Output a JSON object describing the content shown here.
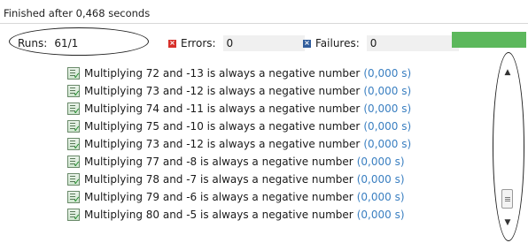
{
  "status": "Finished after 0,468 seconds",
  "counters": {
    "runs_label": "Runs:",
    "runs_value": "61/1",
    "errors_label": "Errors:",
    "errors_value": "0",
    "failures_label": "Failures:",
    "failures_value": "0"
  },
  "progress": {
    "fraction": 1.0,
    "color": "#5cb85c"
  },
  "tests": [
    {
      "name": "Multiplying  72 and -13 is always a negative number",
      "time": "(0,000 s)"
    },
    {
      "name": "Multiplying  73 and -12 is always a negative number",
      "time": "(0,000 s)"
    },
    {
      "name": "Multiplying  74 and -11 is always a negative number",
      "time": "(0,000 s)"
    },
    {
      "name": "Multiplying  75 and -10 is always a negative number",
      "time": "(0,000 s)"
    },
    {
      "name": "Multiplying  73 and -12 is always a negative number",
      "time": "(0,000 s)"
    },
    {
      "name": "Multiplying  77 and -8 is always a negative number",
      "time": "(0,000 s)"
    },
    {
      "name": "Multiplying  78 and -7 is always a negative number",
      "time": "(0,000 s)"
    },
    {
      "name": "Multiplying  79 and -6 is always a negative number",
      "time": "(0,000 s)"
    },
    {
      "name": "Multiplying  80 and -5 is always a negative number",
      "time": "(0,000 s)"
    }
  ],
  "icons": {
    "test": "test-passed-icon",
    "error": "error-icon",
    "failure": "failure-icon",
    "scroll_up": "scroll-up-icon",
    "scroll_down": "scroll-down-icon"
  }
}
